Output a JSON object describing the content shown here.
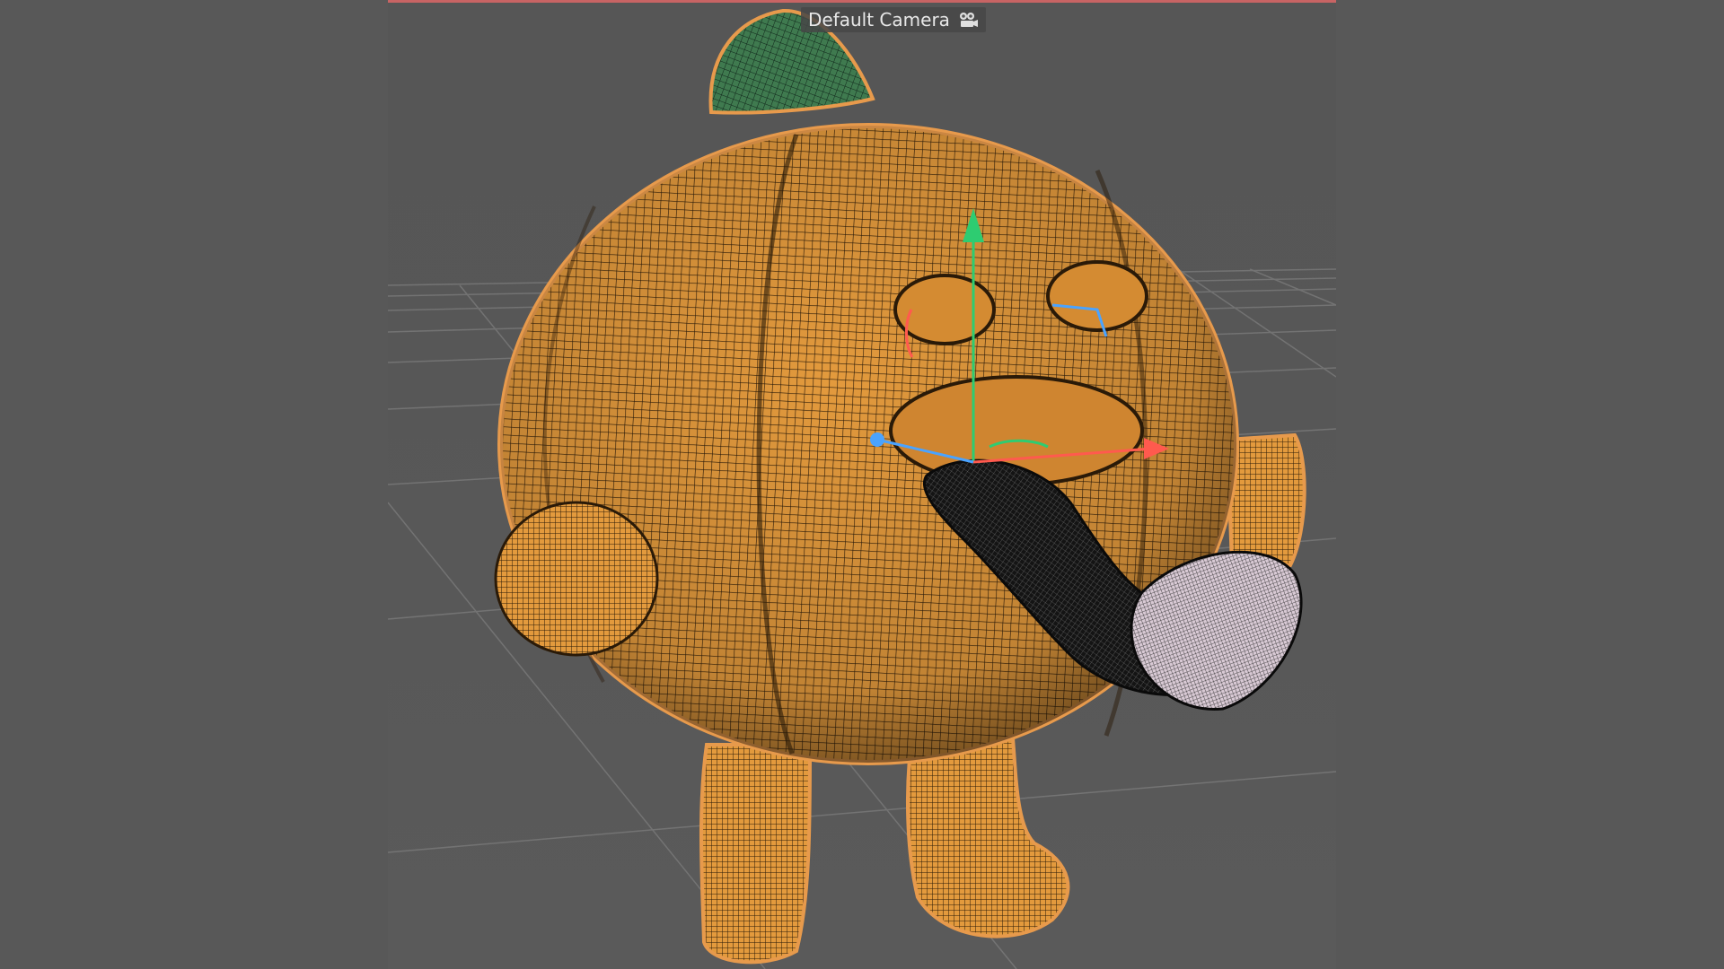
{
  "viewport": {
    "camera_label": "Default Camera"
  },
  "colors": {
    "background": "#585858",
    "pumpkin_body": "#e39a3d",
    "pumpkin_outline": "#e79a4c",
    "stem": "#3f7a4f",
    "tongue": "#1b1b1b",
    "tongue_tip": "#d8c9d4",
    "axis_y": "#2ecc71",
    "axis_x": "#ff5a4e",
    "axis_z": "#4aa3ff",
    "selection_border": "#c86464"
  },
  "icons": {
    "camera": "camera-icon"
  }
}
